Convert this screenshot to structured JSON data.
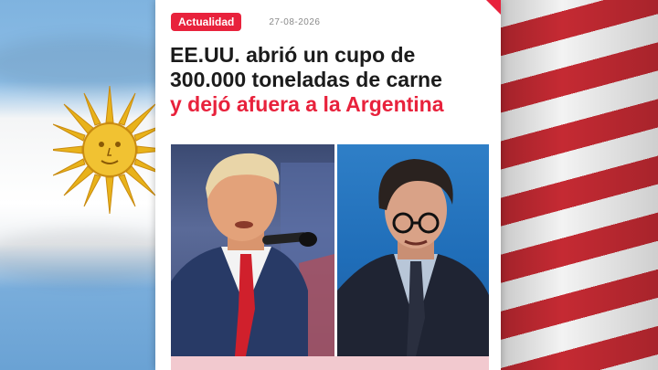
{
  "article": {
    "category": "Actualidad",
    "date": "27-08-2026",
    "headline_part1": "EE.UU. abrió un cupo de 300.000 toneladas de carne",
    "headline_part2": "y dejó afuera a la Argentina"
  },
  "colors": {
    "accent_red": "#e8223c",
    "headline_dark": "#1b1b1b",
    "argentina_blue": "#7fb3df",
    "us_red": "#c52a33"
  },
  "images": {
    "left_photo": "man-speaking-at-microphone",
    "right_photo": "man-with-glasses-speaking",
    "background_left": "argentina-flag",
    "background_right": "usa-flag"
  }
}
